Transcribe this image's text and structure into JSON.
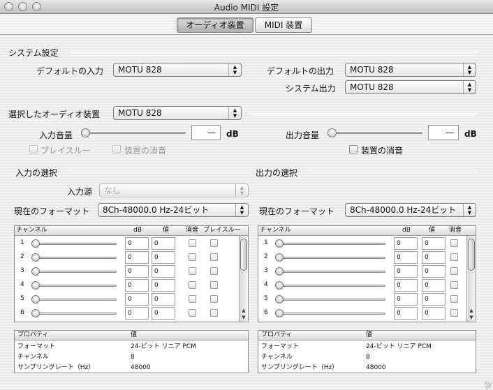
{
  "window": {
    "title": "Audio MIDI 設定"
  },
  "tabs": [
    {
      "label": "オーディオ装置"
    },
    {
      "label": "MIDI 装置"
    }
  ],
  "system": {
    "section_label": "システム設定",
    "default_input_label": "デフォルトの入力",
    "default_input_value": "MOTU 828",
    "default_output_label": "デフォルトの出力",
    "default_output_value": "MOTU 828",
    "system_output_label": "システム出力",
    "system_output_value": "MOTU 828"
  },
  "device": {
    "selected_label": "選択したオーディオ装置",
    "selected_value": "MOTU 828",
    "input_volume_label": "入力音量",
    "input_volume_value": "—",
    "db_unit": "dB",
    "output_volume_label": "出力音量",
    "output_volume_value": "—",
    "playthrough_label": "プレイスルー",
    "input_mute_label": "装置の消音",
    "output_mute_label": "装置の消音"
  },
  "input": {
    "section_label": "入力の選択",
    "source_label": "入力源",
    "source_value": "なし",
    "format_label": "現在のフォーマット",
    "format_value": "8Ch-48000.0 Hz-24ビット",
    "columns": {
      "channel": "チャンネル",
      "db": "dB",
      "value": "値",
      "mute": "消音",
      "thru": "プレイスルー"
    },
    "channels": [
      {
        "n": "1",
        "db": "0",
        "v": "0"
      },
      {
        "n": "2",
        "db": "0",
        "v": "0"
      },
      {
        "n": "3",
        "db": "0",
        "v": "0"
      },
      {
        "n": "4",
        "db": "0",
        "v": "0"
      },
      {
        "n": "5",
        "db": "0",
        "v": "0"
      },
      {
        "n": "6",
        "db": "0",
        "v": "0"
      }
    ],
    "prop_header": {
      "property": "プロパティ",
      "value": "値"
    },
    "props": [
      {
        "k": "フォーマット",
        "v": "24-ビット リニア PCM"
      },
      {
        "k": "チャンネル",
        "v": "8"
      },
      {
        "k": "サンプリングレート（Hz）",
        "v": "48000"
      }
    ]
  },
  "output": {
    "section_label": "出力の選択",
    "format_label": "現在のフォーマット",
    "format_value": "8Ch-48000.0 Hz-24ビット",
    "columns": {
      "channel": "チャンネル",
      "db": "dB",
      "value": "値",
      "mute": "消音"
    },
    "channels": [
      {
        "n": "1",
        "db": "0",
        "v": "0"
      },
      {
        "n": "2",
        "db": "0",
        "v": "0"
      },
      {
        "n": "3",
        "db": "0",
        "v": "0"
      },
      {
        "n": "4",
        "db": "0",
        "v": "0"
      },
      {
        "n": "5",
        "db": "0",
        "v": "0"
      },
      {
        "n": "6",
        "db": "0",
        "v": "0"
      }
    ],
    "prop_header": {
      "property": "プロパティ",
      "value": "値"
    },
    "props": [
      {
        "k": "フォーマット",
        "v": "24-ビット リニア PCM"
      },
      {
        "k": "チャンネル",
        "v": "8"
      },
      {
        "k": "サンプリングレート（Hz）",
        "v": "48000"
      }
    ]
  }
}
